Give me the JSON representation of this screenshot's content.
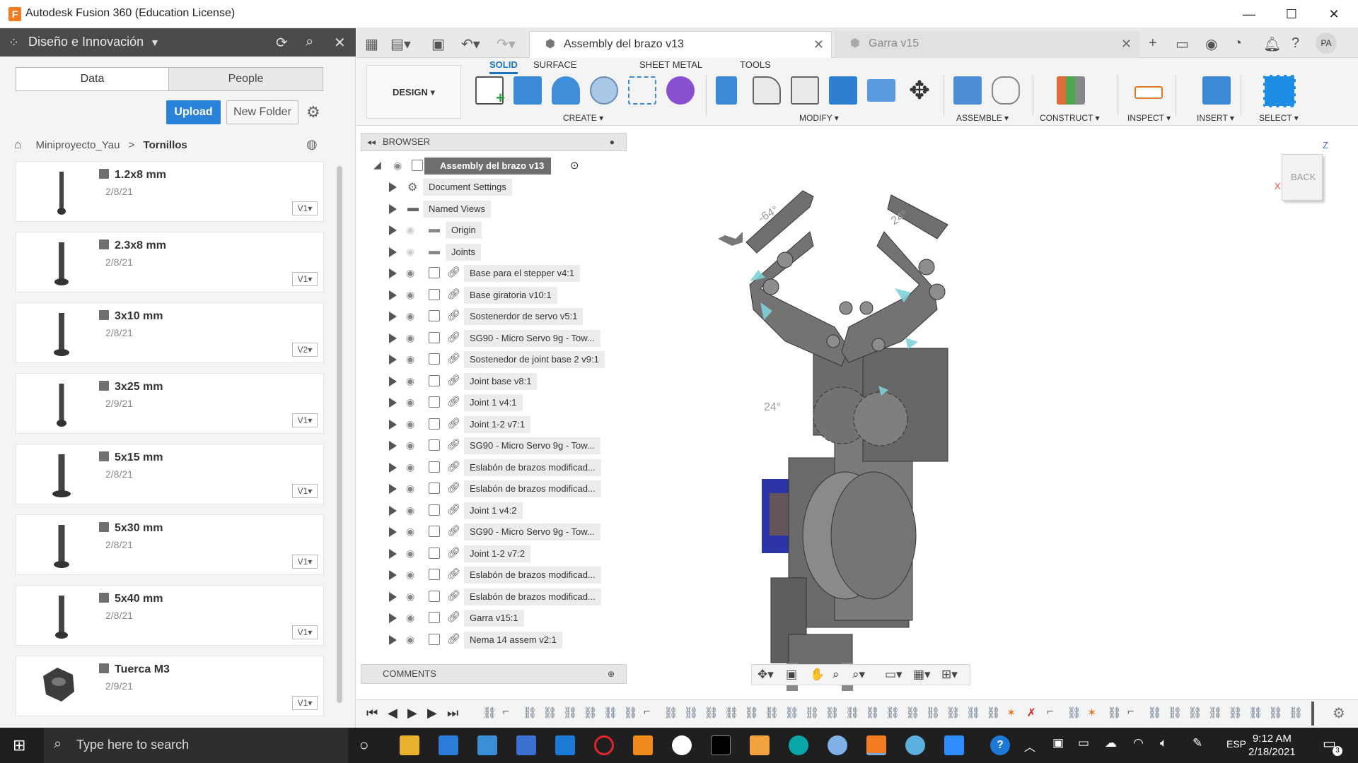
{
  "app": {
    "title": "Autodesk Fusion 360 (Education License)"
  },
  "data_panel": {
    "project_name": "Diseño e Innovación",
    "tabs": [
      "Data",
      "People"
    ],
    "upload_label": "Upload",
    "new_folder_label": "New Folder",
    "breadcrumb": [
      "Miniproyecto_Yau",
      "Tornillos"
    ],
    "files": [
      {
        "name": "1.2x8 mm",
        "date": "2/8/21",
        "version": "V1"
      },
      {
        "name": "2.3x8 mm",
        "date": "2/8/21",
        "version": "V1"
      },
      {
        "name": "3x10 mm",
        "date": "2/8/21",
        "version": "V2"
      },
      {
        "name": "3x25 mm",
        "date": "2/9/21",
        "version": "V1"
      },
      {
        "name": "5x15 mm",
        "date": "2/8/21",
        "version": "V1"
      },
      {
        "name": "5x30 mm",
        "date": "2/8/21",
        "version": "V1"
      },
      {
        "name": "5x40 mm",
        "date": "2/8/21",
        "version": "V1"
      },
      {
        "name": "Tuerca M3",
        "date": "2/9/21",
        "version": "V1"
      }
    ]
  },
  "doc_tabs": [
    {
      "label": "Assembly del brazo v13",
      "active": true
    },
    {
      "label": "Garra v15",
      "active": false
    }
  ],
  "user_initials": "PA",
  "toolbar": {
    "workspace": "DESIGN",
    "categories": [
      "SOLID",
      "SURFACE",
      "SHEET METAL",
      "TOOLS"
    ],
    "groups": [
      "CREATE",
      "MODIFY",
      "ASSEMBLE",
      "CONSTRUCT",
      "INSPECT",
      "INSERT",
      "SELECT"
    ]
  },
  "browser": {
    "title": "BROWSER",
    "root": "Assembly del brazo v13",
    "items": [
      "Document Settings",
      "Named Views",
      "Origin",
      "Joints",
      "Base para el stepper v4:1",
      "Base giratoria v10:1",
      "Sostenerdor de servo v5:1",
      "SG90 - Micro Servo 9g - Tow...",
      "Sostenedor de joint base 2 v9:1",
      "Joint base v8:1",
      "Joint 1 v4:1",
      "Joint 1-2 v7:1",
      "SG90 - Micro Servo 9g - Tow...",
      "Eslabón de brazos modificad...",
      "Eslabón de brazos modificad...",
      "Joint 1 v4:2",
      "SG90 - Micro Servo 9g - Tow...",
      "Joint 1-2 v7:2",
      "Eslabón de brazos modificad...",
      "Eslabón de brazos modificad...",
      "Garra v15:1",
      "Nema 14 assem v2:1"
    ],
    "comments_label": "COMMENTS"
  },
  "viewport": {
    "viewcube_label": "BACK",
    "axis_z": "Z",
    "axis_x": "X",
    "angle_labels": [
      "-64°",
      "24°",
      "24°"
    ]
  },
  "taskbar": {
    "search_placeholder": "Type here to search",
    "language": "ESP",
    "time": "9:12 AM",
    "date": "2/18/2021",
    "notifications": "3"
  },
  "colors": {
    "accent": "#1a73c8",
    "upload": "#2b82d9",
    "panel_header": "#4b4b4b",
    "model_gray": "#6f6f6f",
    "servo_blue": "#2c34a8"
  }
}
